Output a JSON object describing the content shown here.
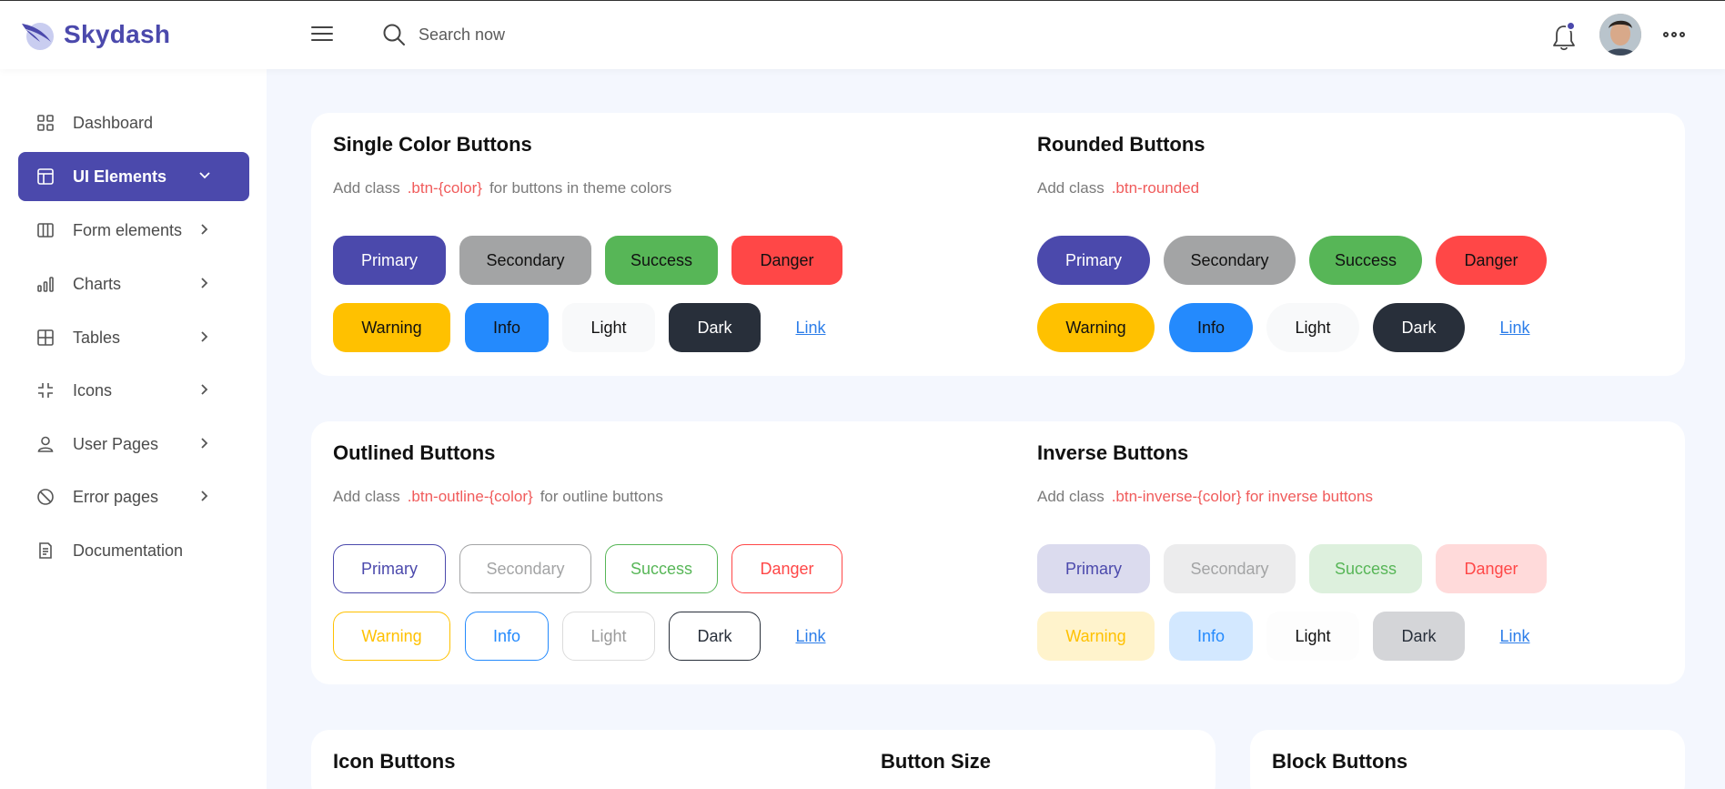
{
  "app": {
    "name": "Skydash"
  },
  "colors": {
    "primary": "#4b49ac",
    "secondary": "#a3a4a5",
    "success": "#57b657",
    "danger": "#ff4747",
    "warning": "#ffc100",
    "info": "#248afd",
    "light": "#f8f9fa",
    "dark": "#282f3a",
    "link": "#2b7de9",
    "code": "#f05b5b"
  },
  "header": {
    "search_placeholder": "Search now",
    "icons": [
      "menu-icon",
      "search-icon",
      "bell-icon",
      "avatar",
      "more-icon"
    ]
  },
  "sidebar": {
    "items": [
      {
        "label": "Dashboard",
        "icon": "grid-icon",
        "active": false,
        "has_children": false
      },
      {
        "label": "UI Elements",
        "icon": "layout-icon",
        "active": true,
        "has_children": true
      },
      {
        "label": "Form elements",
        "icon": "columns-icon",
        "active": false,
        "has_children": true
      },
      {
        "label": "Charts",
        "icon": "bar-chart-icon",
        "active": false,
        "has_children": true
      },
      {
        "label": "Tables",
        "icon": "table-icon",
        "active": false,
        "has_children": true
      },
      {
        "label": "Icons",
        "icon": "shrink-icon",
        "active": false,
        "has_children": true
      },
      {
        "label": "User Pages",
        "icon": "user-icon",
        "active": false,
        "has_children": true
      },
      {
        "label": "Error pages",
        "icon": "ban-icon",
        "active": false,
        "has_children": true
      },
      {
        "label": "Documentation",
        "icon": "document-icon",
        "active": false,
        "has_children": false
      }
    ]
  },
  "buttons": {
    "primary": "Primary",
    "secondary": "Secondary",
    "success": "Success",
    "danger": "Danger",
    "warning": "Warning",
    "info": "Info",
    "light": "Light",
    "dark": "Dark",
    "link": "Link"
  },
  "sections": {
    "single": {
      "title": "Single Color Buttons",
      "desc_before": "Add class",
      "code": ".btn-{color}",
      "desc_after": "for buttons in theme colors"
    },
    "rounded": {
      "title": "Rounded Buttons",
      "desc_before": "Add class",
      "code": ".btn-rounded",
      "desc_after": ""
    },
    "outlined": {
      "title": "Outlined Buttons",
      "desc_before": "Add class",
      "code": ".btn-outline-{color}",
      "desc_after": "for outline buttons"
    },
    "inverse": {
      "title": "Inverse Buttons",
      "desc_before": "Add class",
      "code": ".btn-inverse-{color} for inverse buttons",
      "desc_after": ""
    },
    "icon": {
      "title": "Icon Buttons"
    },
    "size": {
      "title": "Button Size"
    },
    "block": {
      "title": "Block Buttons"
    }
  }
}
